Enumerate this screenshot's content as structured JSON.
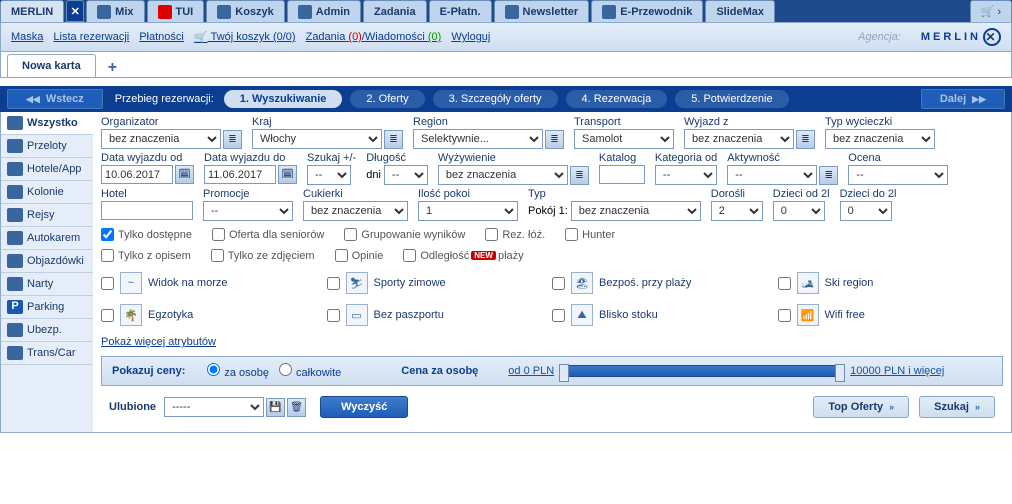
{
  "topTabs": [
    "Mix",
    "TUI",
    "Koszyk",
    "Admin",
    "Zadania",
    "E-Płatn.",
    "Newsletter",
    "E-Przewodnik",
    "SlideMax"
  ],
  "menu": {
    "maska": "Maska",
    "lista": "Lista rezerwacji",
    "platnosci": "Płatności",
    "koszyk": "Twój koszyk (0/0)",
    "zadania_pre": "Zadania ",
    "zadania_cnt": "(0)",
    "wiadomosci_pre": "Wiadomości ",
    "wiadomosci_cnt": "(0)",
    "wyloguj": "Wyloguj",
    "agencja": "Agencja:",
    "logo": "MERLIN"
  },
  "cardTab": "Nowa karta",
  "steps": {
    "back": "Wstecz",
    "label": "Przebieg rezerwacji:",
    "s1": "1. Wyszukiwanie",
    "s2": "2. Oferty",
    "s3": "3. Szczegóły oferty",
    "s4": "4. Rezerwacja",
    "s5": "5. Potwierdzenie",
    "fwd": "Dalej"
  },
  "sidebar": [
    "Wszystko",
    "Przeloty",
    "Hotele/App",
    "Kolonie",
    "Rejsy",
    "Autokarem",
    "Objazdówki",
    "Narty",
    "Parking",
    "Ubezp.",
    "Trans/Car"
  ],
  "filters": {
    "organizator": {
      "label": "Organizator",
      "value": "bez znaczenia"
    },
    "kraj": {
      "label": "Kraj",
      "value": "Włochy"
    },
    "region": {
      "label": "Region",
      "value": "Selektywnie..."
    },
    "transport": {
      "label": "Transport",
      "value": "Samolot"
    },
    "wyjazdz": {
      "label": "Wyjazd z",
      "value": "bez znaczenia"
    },
    "typwyc": {
      "label": "Typ wycieczki",
      "value": "bez znaczenia"
    },
    "dataod": {
      "label": "Data wyjazdu od",
      "value": "10.06.2017"
    },
    "datado": {
      "label": "Data wyjazdu do",
      "value": "11.06.2017"
    },
    "szukaj": {
      "label": "Szukaj +/-",
      "value": "--"
    },
    "dlugosc": {
      "label": "Długość",
      "pre": "dni",
      "value": "--"
    },
    "wyzywienie": {
      "label": "Wyżywienie",
      "value": "bez znaczenia"
    },
    "katalog": {
      "label": "Katalog",
      "value": ""
    },
    "kategoria": {
      "label": "Kategoria od",
      "value": "--"
    },
    "aktywnosc": {
      "label": "Aktywność",
      "value": "--"
    },
    "ocena": {
      "label": "Ocena",
      "value": "--"
    },
    "hotel": {
      "label": "Hotel",
      "value": ""
    },
    "promocje": {
      "label": "Promocje",
      "value": "--"
    },
    "cukierki": {
      "label": "Cukierki",
      "value": "bez znaczenia"
    },
    "iloscpokoi": {
      "label": "Ilość pokoi",
      "value": "1"
    },
    "typ": {
      "label": "Typ",
      "pre": "Pokój 1:",
      "value": "bez znaczenia"
    },
    "dorosli": {
      "label": "Dorośli",
      "value": "2"
    },
    "dzieci2l": {
      "label": "Dzieci od 2l",
      "value": "0"
    },
    "dziecido2l": {
      "label": "Dzieci do 2l",
      "value": "0"
    }
  },
  "checks": {
    "tylkoDostepne": "Tylko dostępne",
    "ofertaSenior": "Oferta dla seniorów",
    "grupowanie": "Grupowanie wyników",
    "rezLoz": "Rez. łóż.",
    "hunter": "Hunter",
    "tylkoOpis": "Tylko z opisem",
    "tylkoZdj": "Tylko ze zdjęciem",
    "opinie": "Opinie",
    "odleglosc_pre": "Odległość",
    "odleglosc_suf": "plaży"
  },
  "attrs": {
    "widok": "Widok na morze",
    "egzotyka": "Egzotyka",
    "sporty": "Sporty zimowe",
    "bezpaszportu": "Bez paszportu",
    "bezposplazy": "Bezpoś. przy plaży",
    "bliskostoku": "Blisko stoku",
    "ski": "Ski region",
    "wifi": "Wifi free",
    "more": "Pokaż więcej atrybutów"
  },
  "price": {
    "show": "Pokazuj ceny:",
    "zaosobe": "za osobę",
    "calkowite": "całkowite",
    "cenaLbl": "Cena za osobę",
    "from": "od 0 PLN",
    "to": "10000 PLN i więcej"
  },
  "bottom": {
    "ulubione": "Ulubione",
    "sel": "-----",
    "wyczysc": "Wyczyść",
    "topoferty": "Top Oferty",
    "szukaj": "Szukaj"
  }
}
